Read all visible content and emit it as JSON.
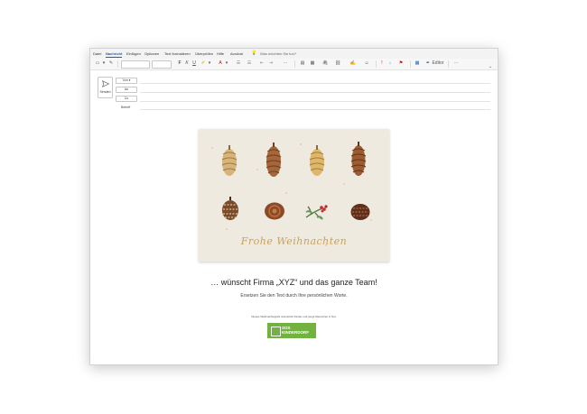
{
  "menu": {
    "items": [
      "Datei",
      "Nachricht",
      "Einfügen",
      "Optionen",
      "Text formatieren",
      "Überprüfen",
      "Hilfe",
      "Acrobat"
    ],
    "active_index": 1,
    "search_placeholder": "Was möchten Sie tun?"
  },
  "ribbon": {
    "editor_label": "Editor",
    "more_label": "···"
  },
  "compose": {
    "send_label": "Senden",
    "from_label": "Von",
    "to_label": "An",
    "cc_label": "Cc",
    "subject_label": "Betreff"
  },
  "card": {
    "greeting": "Frohe Weihnachten"
  },
  "body": {
    "headline": "… wünscht Firma „XYZ“ und das ganze Team!",
    "subline": "Ersetzen Sie den Text durch Ihre persönlichen Worte.",
    "small_note": "Dieses Weihnachtsgrüß unterstützt Kinder und junge Menschen in Not."
  },
  "logo": {
    "line1": "SOS",
    "line2": "KINDERDORF"
  },
  "colors": {
    "accent": "#1f5fb0",
    "card_bg": "#efeae0",
    "greeting_gold": "#c8a25c",
    "logo_green": "#72b33f"
  }
}
